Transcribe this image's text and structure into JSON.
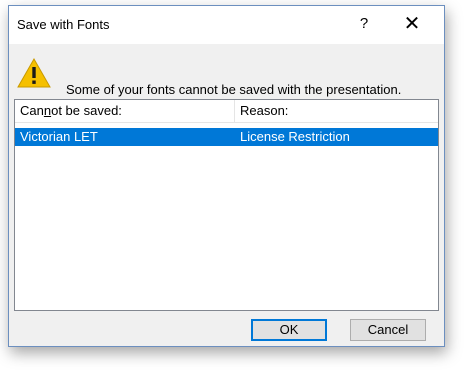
{
  "dialog": {
    "title": "Save with Fonts",
    "help_label": "?",
    "close_label": "✕",
    "warning_icon": "warning-triangle-icon",
    "message": "Some of your fonts cannot be saved with the presentation."
  },
  "list": {
    "columns": [
      {
        "label_pre": "Can",
        "label_mnemonic": "n",
        "label_post": "ot be saved:"
      },
      {
        "label": "Reason:"
      }
    ],
    "rows": [
      {
        "font": "Victorian LET",
        "reason": "License Restriction",
        "selected": true
      }
    ]
  },
  "buttons": {
    "ok_label": "OK",
    "cancel_label": "Cancel"
  },
  "colors": {
    "selection": "#0078d7",
    "warning": "#f5c000",
    "dialog_bg": "#f0f0f0"
  }
}
